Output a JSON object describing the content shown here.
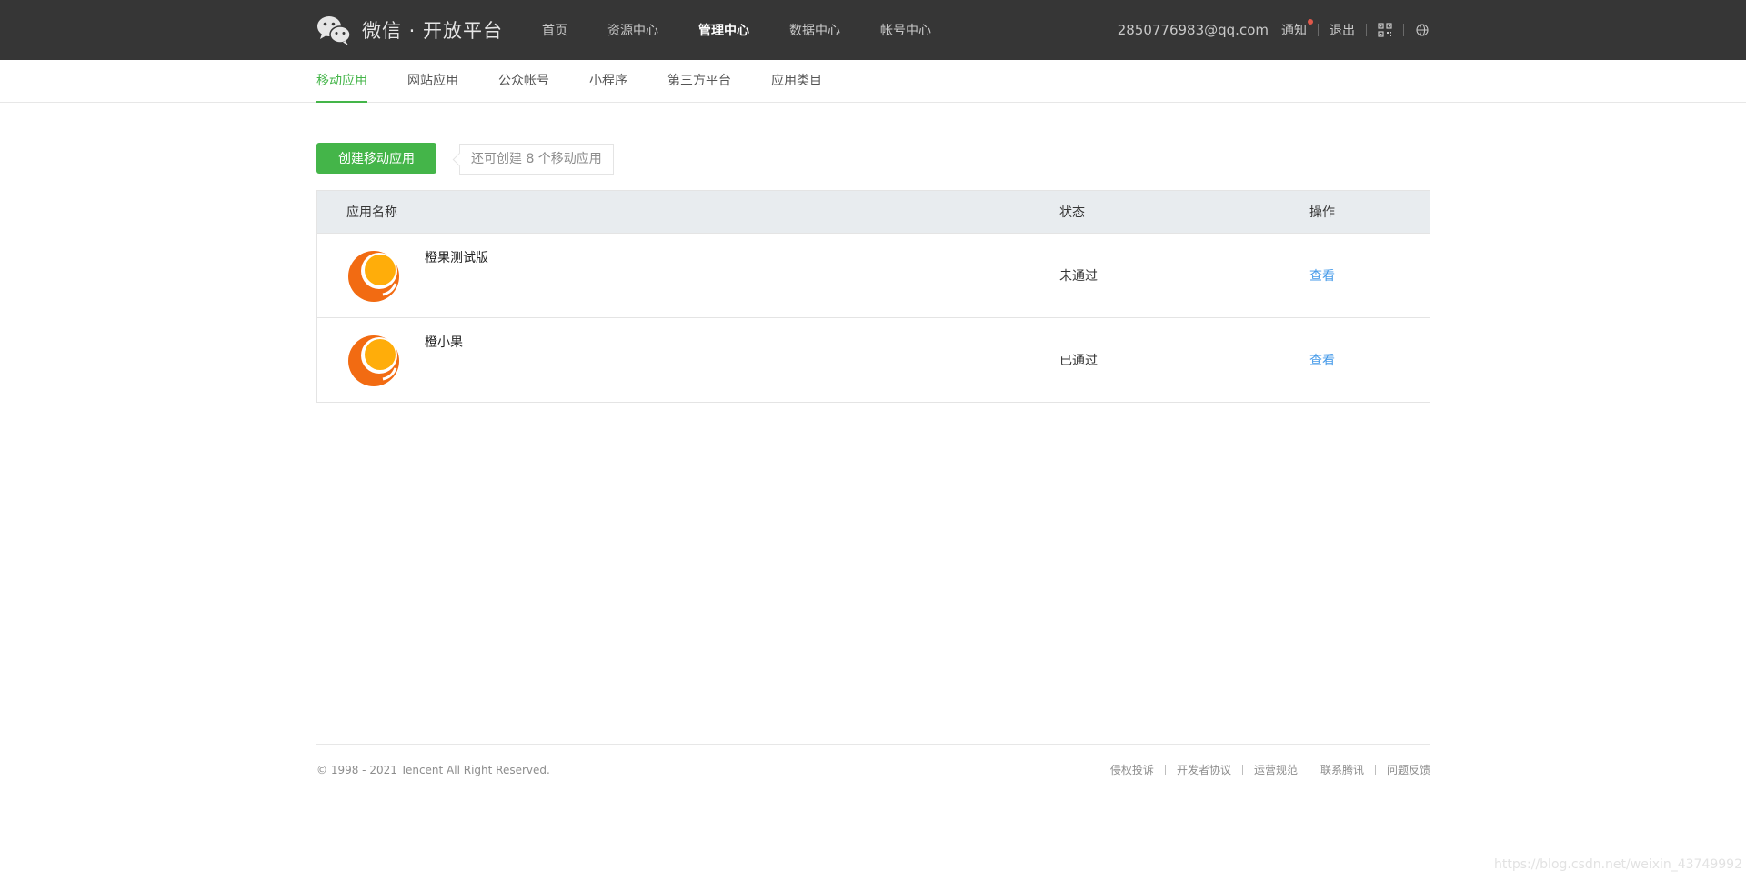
{
  "header": {
    "logo_text": "微信 · 开放平台",
    "nav": [
      {
        "label": "首页",
        "active": false
      },
      {
        "label": "资源中心",
        "active": false
      },
      {
        "label": "管理中心",
        "active": true
      },
      {
        "label": "数据中心",
        "active": false
      },
      {
        "label": "帐号中心",
        "active": false
      }
    ],
    "account_email": "2850776983@qq.com",
    "notify_label": "通知",
    "logout_label": "退出",
    "qr_icon": "qr-code-icon",
    "lang_icon": "globe-icon"
  },
  "subnav": {
    "tabs": [
      {
        "label": "移动应用",
        "active": true
      },
      {
        "label": "网站应用",
        "active": false
      },
      {
        "label": "公众帐号",
        "active": false
      },
      {
        "label": "小程序",
        "active": false
      },
      {
        "label": "第三方平台",
        "active": false
      },
      {
        "label": "应用类目",
        "active": false
      }
    ]
  },
  "main": {
    "create_button": "创建移动应用",
    "quota_text": "还可创建 8 个移动应用",
    "table": {
      "columns": [
        "应用名称",
        "状态",
        "操作"
      ],
      "rows": [
        {
          "name": "橙果测试版",
          "status": "未通过",
          "action": "查看"
        },
        {
          "name": "橙小果",
          "status": "已通过",
          "action": "查看"
        }
      ]
    }
  },
  "footer": {
    "copyright": "© 1998 - 2021 Tencent All Right Reserved.",
    "links": [
      "侵权投诉",
      "开发者协议",
      "运营规范",
      "联系腾讯",
      "问题反馈"
    ]
  },
  "watermark": "https://blog.csdn.net/weixin_43749992",
  "colors": {
    "topbar": "#363636",
    "accent_green": "#44b549",
    "link_blue": "#459ae9",
    "table_header": "#e8ecef",
    "app_logo_orange": "#f26b12",
    "app_logo_yellow": "#ffad0a"
  }
}
